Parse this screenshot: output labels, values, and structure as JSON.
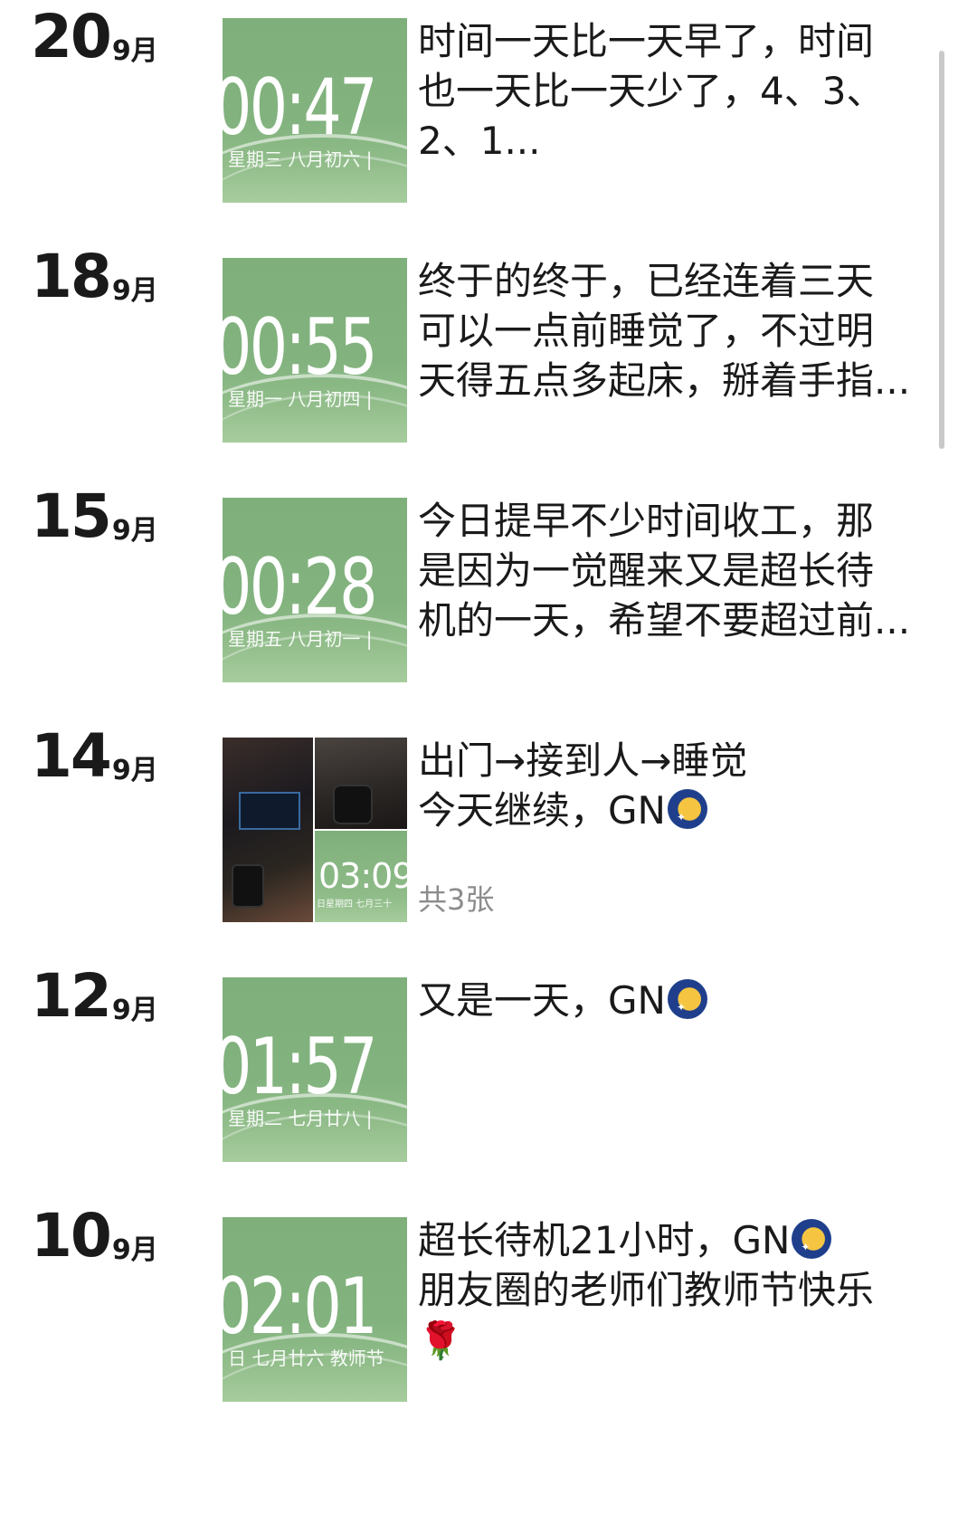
{
  "posts": [
    {
      "day": "20",
      "month": "9月",
      "thumb": {
        "clock": "00:47",
        "sub": "星期三  八月初六  |"
      },
      "lines": [
        "时间一天比一天早了，时间",
        "也一天比一天少了，4、3、",
        "2、1..."
      ]
    },
    {
      "day": "18",
      "month": "9月",
      "thumb": {
        "clock": "00:55",
        "sub": "星期一  八月初四  |"
      },
      "lines": [
        "终于的终于，已经连着三天",
        "可以一点前睡觉了，不过明",
        "天得五点多起床，掰着手指..."
      ]
    },
    {
      "day": "15",
      "month": "9月",
      "thumb": {
        "clock": "00:28",
        "sub": "星期五  八月初一  |"
      },
      "lines": [
        "今日提早不少时间收工，那",
        "是因为一觉醒来又是超长待",
        "机的一天，希望不要超过前..."
      ]
    },
    {
      "day": "14",
      "month": "9月",
      "grid": {
        "mini_clock": "03:09",
        "mini_sub": "日星期四  七月三十"
      },
      "lines": [
        "出门→接到人→睡觉",
        "今天继续，GN"
      ],
      "count": "共3张"
    },
    {
      "day": "12",
      "month": "9月",
      "thumb": {
        "clock": "01:57",
        "sub": "星期二  七月廿八  |"
      },
      "lines": [
        "又是一天，GN"
      ]
    },
    {
      "day": "10",
      "month": "9月",
      "thumb": {
        "clock": "02:01",
        "sub": "日  七月廿六  教师节"
      },
      "lines": [
        "超长待机21小时，GN",
        "朋友圈的老师们教师节快乐",
        ""
      ]
    }
  ]
}
